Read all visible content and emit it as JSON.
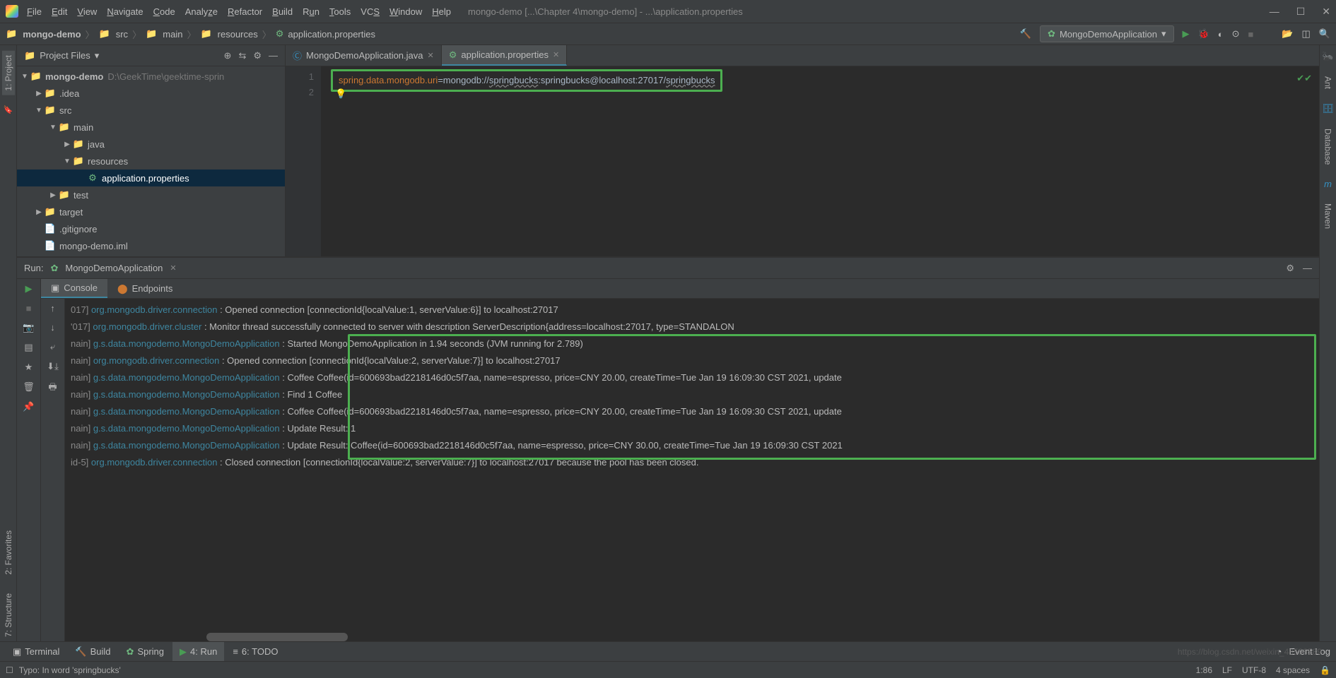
{
  "title": "mongo-demo [...\\Chapter 4\\mongo-demo] - ...\\application.properties",
  "menu": [
    "File",
    "Edit",
    "View",
    "Navigate",
    "Code",
    "Analyze",
    "Refactor",
    "Build",
    "Run",
    "Tools",
    "VCS",
    "Window",
    "Help"
  ],
  "breadcrumb": [
    "mongo-demo",
    "src",
    "main",
    "resources",
    "application.properties"
  ],
  "run_config": "MongoDemoApplication",
  "project_panel": {
    "title": "Project Files",
    "root": {
      "name": "mongo-demo",
      "path": "D:\\GeekTime\\geektime-sprin"
    },
    "tree": [
      {
        "indent": 1,
        "arrow": "▶",
        "icon": "folder",
        "label": ".idea"
      },
      {
        "indent": 1,
        "arrow": "▼",
        "icon": "folder",
        "label": "src"
      },
      {
        "indent": 2,
        "arrow": "▼",
        "icon": "folder",
        "label": "main"
      },
      {
        "indent": 3,
        "arrow": "▶",
        "icon": "folder",
        "label": "java"
      },
      {
        "indent": 3,
        "arrow": "▼",
        "icon": "folder",
        "label": "resources"
      },
      {
        "indent": 4,
        "arrow": "",
        "icon": "props",
        "label": "application.properties",
        "selected": true
      },
      {
        "indent": 2,
        "arrow": "▶",
        "icon": "folder",
        "label": "test"
      },
      {
        "indent": 1,
        "arrow": "▶",
        "icon": "folder-orange",
        "label": "target"
      },
      {
        "indent": 1,
        "arrow": "",
        "icon": "file",
        "label": ".gitignore"
      },
      {
        "indent": 1,
        "arrow": "",
        "icon": "file",
        "label": "mongo-demo.iml"
      }
    ]
  },
  "editor": {
    "tabs": [
      {
        "label": "MongoDemoApplication.java",
        "active": false
      },
      {
        "label": "application.properties",
        "active": true
      }
    ],
    "line1_key": "spring.data.mongodb.uri",
    "line1_eq": "=",
    "line1_val_pre": "mongodb://",
    "line1_user": "springbucks",
    "line1_mid": ":springbucks@localhost:27017/",
    "line1_db": "springbucks",
    "line_numbers": [
      "1",
      "2"
    ]
  },
  "run_panel": {
    "label": "Run:",
    "config": "MongoDemoApplication",
    "tabs": [
      "Console",
      "Endpoints"
    ],
    "lines": [
      {
        "thread": "017]",
        "logger": "org.mongodb.driver.connection",
        "msg": "Opened connection [connectionId{localValue:1, serverValue:6}] to localhost:27017"
      },
      {
        "thread": "'017]",
        "logger": "org.mongodb.driver.cluster",
        "msg": "Monitor thread successfully connected to server with description ServerDescription{address=localhost:27017, type=STANDALON"
      },
      {
        "thread": "nain]",
        "logger": "g.s.data.mongodemo.MongoDemoApplication",
        "msg": "Started MongoDemoApplication in 1.94 seconds (JVM running for 2.789)"
      },
      {
        "thread": "nain]",
        "logger": "org.mongodb.driver.connection",
        "msg": "Opened connection [connectionId{localValue:2, serverValue:7}] to localhost:27017"
      },
      {
        "thread": "nain]",
        "logger": "g.s.data.mongodemo.MongoDemoApplication",
        "msg": "Coffee Coffee(id=600693bad2218146d0c5f7aa, name=espresso, price=CNY 20.00, createTime=Tue Jan 19 16:09:30 CST 2021, update"
      },
      {
        "thread": "nain]",
        "logger": "g.s.data.mongodemo.MongoDemoApplication",
        "msg": "Find 1 Coffee"
      },
      {
        "thread": "nain]",
        "logger": "g.s.data.mongodemo.MongoDemoApplication",
        "msg": "Coffee Coffee(id=600693bad2218146d0c5f7aa, name=espresso, price=CNY 20.00, createTime=Tue Jan 19 16:09:30 CST 2021, update"
      },
      {
        "thread": "nain]",
        "logger": "g.s.data.mongodemo.MongoDemoApplication",
        "msg": "Update Result: 1"
      },
      {
        "thread": "nain]",
        "logger": "g.s.data.mongodemo.MongoDemoApplication",
        "msg": "Update Result: Coffee(id=600693bad2218146d0c5f7aa, name=espresso, price=CNY 30.00, createTime=Tue Jan 19 16:09:30 CST 2021"
      },
      {
        "thread": "id-5]",
        "logger": "org.mongodb.driver.connection",
        "msg": "Closed connection [connectionId{localValue:2, serverValue:7}] to localhost:27017 because the pool has been closed."
      }
    ]
  },
  "left_gutter": [
    "1: Project",
    "2: Favorites",
    "7: Structure"
  ],
  "right_gutter": [
    "Ant",
    "Database",
    "Maven"
  ],
  "bottom_tabs": {
    "items": [
      {
        "label": "Terminal",
        "icon": "▣"
      },
      {
        "label": "Build",
        "icon": "🔨"
      },
      {
        "label": "Spring",
        "icon": "✿"
      },
      {
        "label": "4: Run",
        "icon": "▶",
        "active": true
      },
      {
        "label": "6: TODO",
        "icon": "≡"
      }
    ],
    "event_log": "Event Log"
  },
  "status": {
    "left_icon": "☐",
    "left": "Typo: In word 'springbucks'",
    "right": [
      "1:86",
      "LF",
      "UTF-8",
      "4 spaces",
      "🔒"
    ]
  },
  "watermark": "https://blog.csdn.net/weixin_48596589"
}
